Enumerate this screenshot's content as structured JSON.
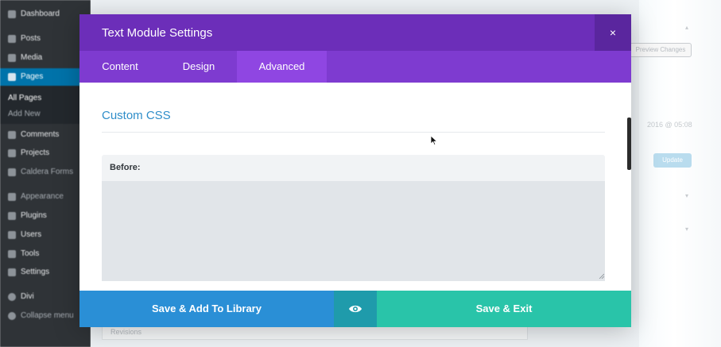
{
  "wp_sidebar": {
    "items": [
      {
        "label": "Dashboard",
        "icon": "dashboard-icon"
      },
      {
        "label": "Posts",
        "icon": "pin-icon"
      },
      {
        "label": "Media",
        "icon": "media-icon"
      },
      {
        "label": "Pages",
        "icon": "pages-icon"
      },
      {
        "label": "All Pages"
      },
      {
        "label": "Add New"
      },
      {
        "label": "Comments",
        "icon": "comments-icon"
      },
      {
        "label": "Projects",
        "icon": "projects-icon"
      },
      {
        "label": "Caldera Forms",
        "icon": "caldera-icon"
      },
      {
        "label": "Appearance",
        "icon": "appearance-icon"
      },
      {
        "label": "Plugins",
        "icon": "plugins-icon"
      },
      {
        "label": "Users",
        "icon": "users-icon"
      },
      {
        "label": "Tools",
        "icon": "tools-icon"
      },
      {
        "label": "Settings",
        "icon": "settings-icon"
      },
      {
        "label": "Divi",
        "icon": "divi-icon"
      },
      {
        "label": "Collapse menu",
        "icon": "collapse-icon"
      }
    ]
  },
  "wp_main": {
    "preview_changes_label": "Preview Changes",
    "date_text": "2016 @ 05:08",
    "update_label": "Update",
    "revisions_label": "Revisions"
  },
  "modal": {
    "title": "Text Module Settings",
    "close_symbol": "×",
    "tabs": [
      {
        "label": "Content",
        "active": false
      },
      {
        "label": "Design",
        "active": false
      },
      {
        "label": "Advanced",
        "active": true
      }
    ],
    "section_title": "Custom CSS",
    "field_label": "Before:",
    "field_value": "",
    "footer": {
      "library_label": "Save & Add To Library",
      "preview_icon": "eye-icon",
      "save_exit_label": "Save & Exit"
    }
  },
  "colors": {
    "header": "#6c2eb9",
    "tabs_bar": "#7e3bd0",
    "active_tab": "#8f46e2",
    "section_title": "#2e8dc9",
    "library_button": "#2a8fd6",
    "preview_button": "#1f9bab",
    "save_exit_button": "#29c4a9"
  }
}
